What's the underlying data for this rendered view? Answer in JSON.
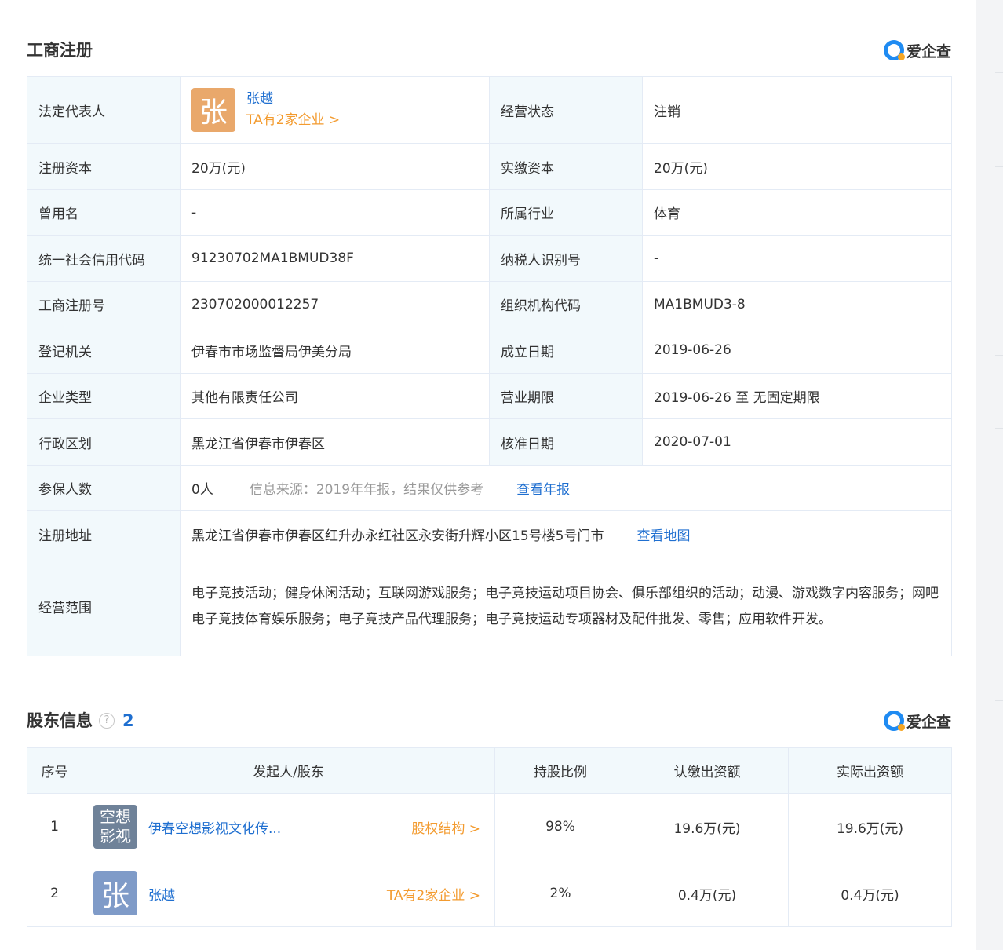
{
  "registration": {
    "title": "工商注册",
    "brand": "爱企查",
    "legal_rep": {
      "label": "法定代表人",
      "avatar_char": "张",
      "name": "张越",
      "link": "TA有2家企业 >"
    },
    "status": {
      "label": "经营状态",
      "value": "注销"
    },
    "rows": [
      {
        "l1": "注册资本",
        "v1": "20万(元)",
        "l2": "实缴资本",
        "v2": "20万(元)"
      },
      {
        "l1": "曾用名",
        "v1": "-",
        "l2": "所属行业",
        "v2": "体育"
      },
      {
        "l1": "统一社会信用代码",
        "v1": "91230702MA1BMUD38F",
        "l2": "纳税人识别号",
        "v2": "-"
      },
      {
        "l1": "工商注册号",
        "v1": "230702000012257",
        "l2": "组织机构代码",
        "v2": "MA1BMUD3-8"
      },
      {
        "l1": "登记机关",
        "v1": "伊春市市场监督局伊美分局",
        "l2": "成立日期",
        "v2": "2019-06-26"
      },
      {
        "l1": "企业类型",
        "v1": "其他有限责任公司",
        "l2": "营业期限",
        "v2": "2019-06-26 至 无固定期限"
      },
      {
        "l1": "行政区划",
        "v1": "黑龙江省伊春市伊春区",
        "l2": "核准日期",
        "v2": "2020-07-01"
      }
    ],
    "insured": {
      "label": "参保人数",
      "value": "0人",
      "note": "信息来源：2019年年报，结果仅供参考",
      "link": "查看年报"
    },
    "address": {
      "label": "注册地址",
      "value": "黑龙江省伊春市伊春区红升办永红社区永安街升辉小区15号楼5号门市",
      "link": "查看地图"
    },
    "scope": {
      "label": "经营范围",
      "value": "电子竞技活动；健身休闲活动；互联网游戏服务；电子竞技运动项目协会、俱乐部组织的活动；动漫、游戏数字内容服务；网吧电子竞技体育娱乐服务；电子竞技产品代理服务；电子竞技运动专项器材及配件批发、零售；应用软件开发。"
    }
  },
  "shareholders": {
    "title": "股东信息",
    "help": "?",
    "count": "2",
    "brand": "爱企查",
    "headers": [
      "序号",
      "发起人/股东",
      "持股比例",
      "认缴出资额",
      "实际出资额"
    ],
    "rows": [
      {
        "index": "1",
        "avatar_line1": "空想",
        "avatar_line2": "影视",
        "name": "伊春空想影视文化传...",
        "link": "股权结构 >",
        "ratio": "98%",
        "subscribed": "19.6万(元)",
        "paid": "19.6万(元)"
      },
      {
        "index": "2",
        "avatar_char": "张",
        "name": "张越",
        "link": "TA有2家企业 >",
        "ratio": "2%",
        "subscribed": "0.4万(元)",
        "paid": "0.4万(元)"
      }
    ]
  }
}
